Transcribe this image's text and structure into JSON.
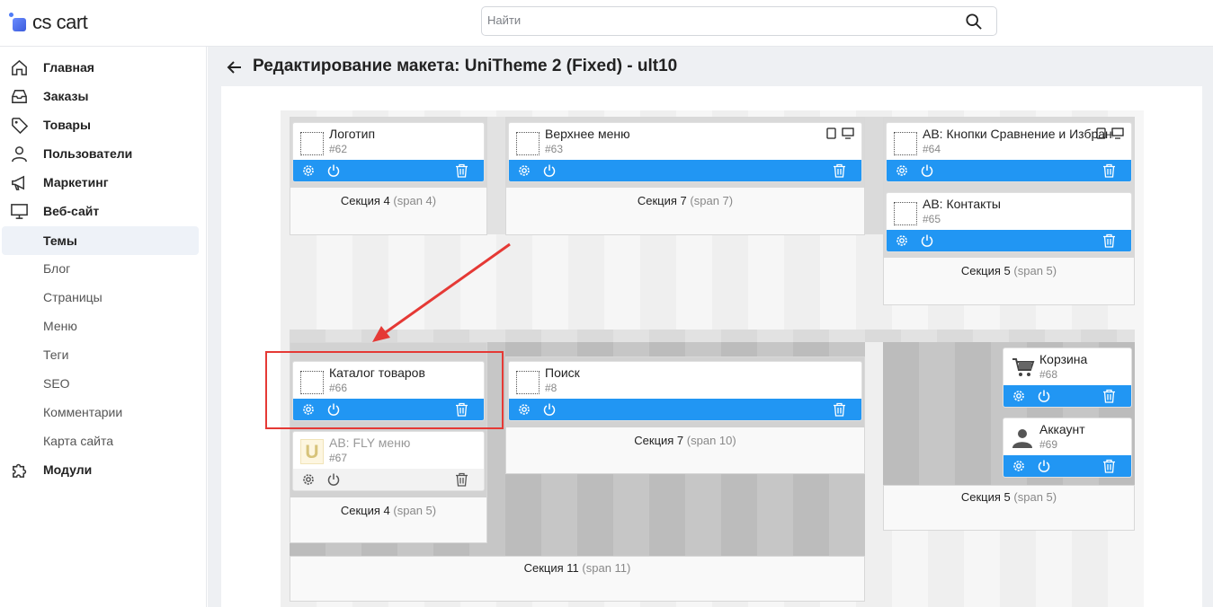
{
  "app": {
    "logo_text": "cs cart"
  },
  "search": {
    "placeholder": "Найти"
  },
  "sidebar": {
    "items": [
      {
        "label": "Главная",
        "icon": "home-icon"
      },
      {
        "label": "Заказы",
        "icon": "inbox-icon"
      },
      {
        "label": "Товары",
        "icon": "tag-icon"
      },
      {
        "label": "Пользователи",
        "icon": "user-icon"
      },
      {
        "label": "Маркетинг",
        "icon": "megaphone-icon"
      },
      {
        "label": "Веб-сайт",
        "icon": "monitor-icon"
      },
      {
        "label": "Темы",
        "active": true
      },
      {
        "label": "Блог"
      },
      {
        "label": "Страницы"
      },
      {
        "label": "Меню"
      },
      {
        "label": "Теги"
      },
      {
        "label": "SEO"
      },
      {
        "label": "Комментарии"
      },
      {
        "label": "Карта сайта"
      },
      {
        "label": "Модули",
        "icon": "puzzle-icon"
      }
    ]
  },
  "page": {
    "title": "Редактирование макета: UniTheme 2 (Fixed) - ult10"
  },
  "sections": [
    {
      "name": "Секция 4",
      "span": "(span 4)"
    },
    {
      "name": "Секция 7",
      "span": "(span 7)"
    },
    {
      "name": "Секция 5",
      "span": "(span 5)"
    },
    {
      "name": "Секция 4",
      "span": "(span 5)"
    },
    {
      "name": "Секция 7",
      "span": "(span 10)"
    },
    {
      "name": "Секция 5",
      "span": "(span 5)"
    },
    {
      "name": "Секция 11",
      "span": "(span 11)"
    }
  ],
  "blocks": [
    {
      "name": "Логотип",
      "id": "#62"
    },
    {
      "name": "Верхнее меню",
      "id": "#63"
    },
    {
      "name": "AB: Кнопки Сравнение и Избранное",
      "id": "#64"
    },
    {
      "name": "AB: Контакты",
      "id": "#65"
    },
    {
      "name": "Каталог товаров",
      "id": "#66"
    },
    {
      "name": "AB: FLY меню",
      "id": "#67",
      "icon_letter": "U"
    },
    {
      "name": "Поиск",
      "id": "#8"
    },
    {
      "name": "Корзина",
      "id": "#68"
    },
    {
      "name": "Аккаунт",
      "id": "#69"
    }
  ],
  "colors": {
    "accent": "#2196f3",
    "highlight": "#e53935"
  }
}
